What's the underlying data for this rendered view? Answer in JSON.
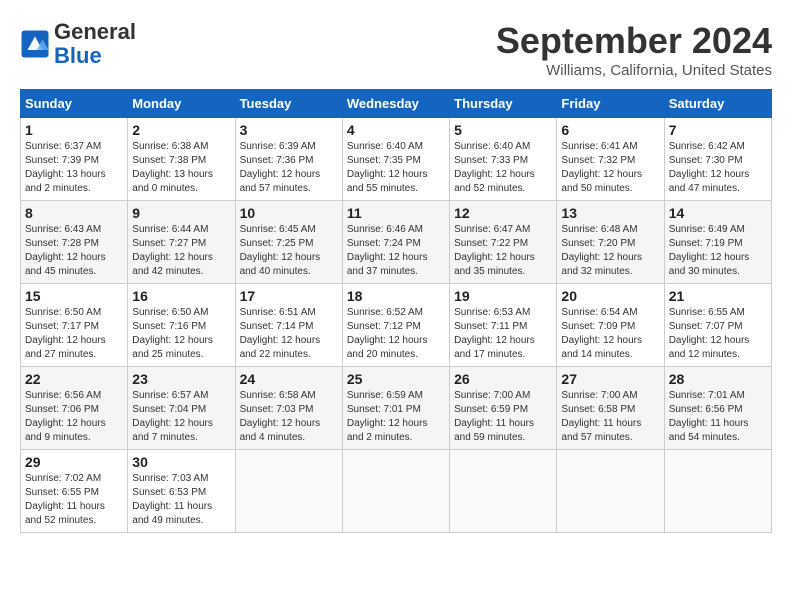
{
  "header": {
    "logo_general": "General",
    "logo_blue": "Blue",
    "month": "September 2024",
    "location": "Williams, California, United States"
  },
  "calendar": {
    "days_of_week": [
      "Sunday",
      "Monday",
      "Tuesday",
      "Wednesday",
      "Thursday",
      "Friday",
      "Saturday"
    ],
    "weeks": [
      [
        {
          "day": "",
          "info": ""
        },
        {
          "day": "",
          "info": ""
        },
        {
          "day": "",
          "info": ""
        },
        {
          "day": "",
          "info": ""
        },
        {
          "day": "",
          "info": ""
        },
        {
          "day": "",
          "info": ""
        },
        {
          "day": "",
          "info": ""
        }
      ]
    ],
    "cells": [
      {
        "day": "1",
        "sunrise": "6:37 AM",
        "sunset": "7:39 PM",
        "daylight": "13 hours and 2 minutes."
      },
      {
        "day": "2",
        "sunrise": "6:38 AM",
        "sunset": "7:38 PM",
        "daylight": "13 hours and 0 minutes."
      },
      {
        "day": "3",
        "sunrise": "6:39 AM",
        "sunset": "7:36 PM",
        "daylight": "12 hours and 57 minutes."
      },
      {
        "day": "4",
        "sunrise": "6:40 AM",
        "sunset": "7:35 PM",
        "daylight": "12 hours and 55 minutes."
      },
      {
        "day": "5",
        "sunrise": "6:40 AM",
        "sunset": "7:33 PM",
        "daylight": "12 hours and 52 minutes."
      },
      {
        "day": "6",
        "sunrise": "6:41 AM",
        "sunset": "7:32 PM",
        "daylight": "12 hours and 50 minutes."
      },
      {
        "day": "7",
        "sunrise": "6:42 AM",
        "sunset": "7:30 PM",
        "daylight": "12 hours and 47 minutes."
      },
      {
        "day": "8",
        "sunrise": "6:43 AM",
        "sunset": "7:28 PM",
        "daylight": "12 hours and 45 minutes."
      },
      {
        "day": "9",
        "sunrise": "6:44 AM",
        "sunset": "7:27 PM",
        "daylight": "12 hours and 42 minutes."
      },
      {
        "day": "10",
        "sunrise": "6:45 AM",
        "sunset": "7:25 PM",
        "daylight": "12 hours and 40 minutes."
      },
      {
        "day": "11",
        "sunrise": "6:46 AM",
        "sunset": "7:24 PM",
        "daylight": "12 hours and 37 minutes."
      },
      {
        "day": "12",
        "sunrise": "6:47 AM",
        "sunset": "7:22 PM",
        "daylight": "12 hours and 35 minutes."
      },
      {
        "day": "13",
        "sunrise": "6:48 AM",
        "sunset": "7:20 PM",
        "daylight": "12 hours and 32 minutes."
      },
      {
        "day": "14",
        "sunrise": "6:49 AM",
        "sunset": "7:19 PM",
        "daylight": "12 hours and 30 minutes."
      },
      {
        "day": "15",
        "sunrise": "6:50 AM",
        "sunset": "7:17 PM",
        "daylight": "12 hours and 27 minutes."
      },
      {
        "day": "16",
        "sunrise": "6:50 AM",
        "sunset": "7:16 PM",
        "daylight": "12 hours and 25 minutes."
      },
      {
        "day": "17",
        "sunrise": "6:51 AM",
        "sunset": "7:14 PM",
        "daylight": "12 hours and 22 minutes."
      },
      {
        "day": "18",
        "sunrise": "6:52 AM",
        "sunset": "7:12 PM",
        "daylight": "12 hours and 20 minutes."
      },
      {
        "day": "19",
        "sunrise": "6:53 AM",
        "sunset": "7:11 PM",
        "daylight": "12 hours and 17 minutes."
      },
      {
        "day": "20",
        "sunrise": "6:54 AM",
        "sunset": "7:09 PM",
        "daylight": "12 hours and 14 minutes."
      },
      {
        "day": "21",
        "sunrise": "6:55 AM",
        "sunset": "7:07 PM",
        "daylight": "12 hours and 12 minutes."
      },
      {
        "day": "22",
        "sunrise": "6:56 AM",
        "sunset": "7:06 PM",
        "daylight": "12 hours and 9 minutes."
      },
      {
        "day": "23",
        "sunrise": "6:57 AM",
        "sunset": "7:04 PM",
        "daylight": "12 hours and 7 minutes."
      },
      {
        "day": "24",
        "sunrise": "6:58 AM",
        "sunset": "7:03 PM",
        "daylight": "12 hours and 4 minutes."
      },
      {
        "day": "25",
        "sunrise": "6:59 AM",
        "sunset": "7:01 PM",
        "daylight": "12 hours and 2 minutes."
      },
      {
        "day": "26",
        "sunrise": "7:00 AM",
        "sunset": "6:59 PM",
        "daylight": "11 hours and 59 minutes."
      },
      {
        "day": "27",
        "sunrise": "7:00 AM",
        "sunset": "6:58 PM",
        "daylight": "11 hours and 57 minutes."
      },
      {
        "day": "28",
        "sunrise": "7:01 AM",
        "sunset": "6:56 PM",
        "daylight": "11 hours and 54 minutes."
      },
      {
        "day": "29",
        "sunrise": "7:02 AM",
        "sunset": "6:55 PM",
        "daylight": "11 hours and 52 minutes."
      },
      {
        "day": "30",
        "sunrise": "7:03 AM",
        "sunset": "6:53 PM",
        "daylight": "11 hours and 49 minutes."
      }
    ]
  }
}
